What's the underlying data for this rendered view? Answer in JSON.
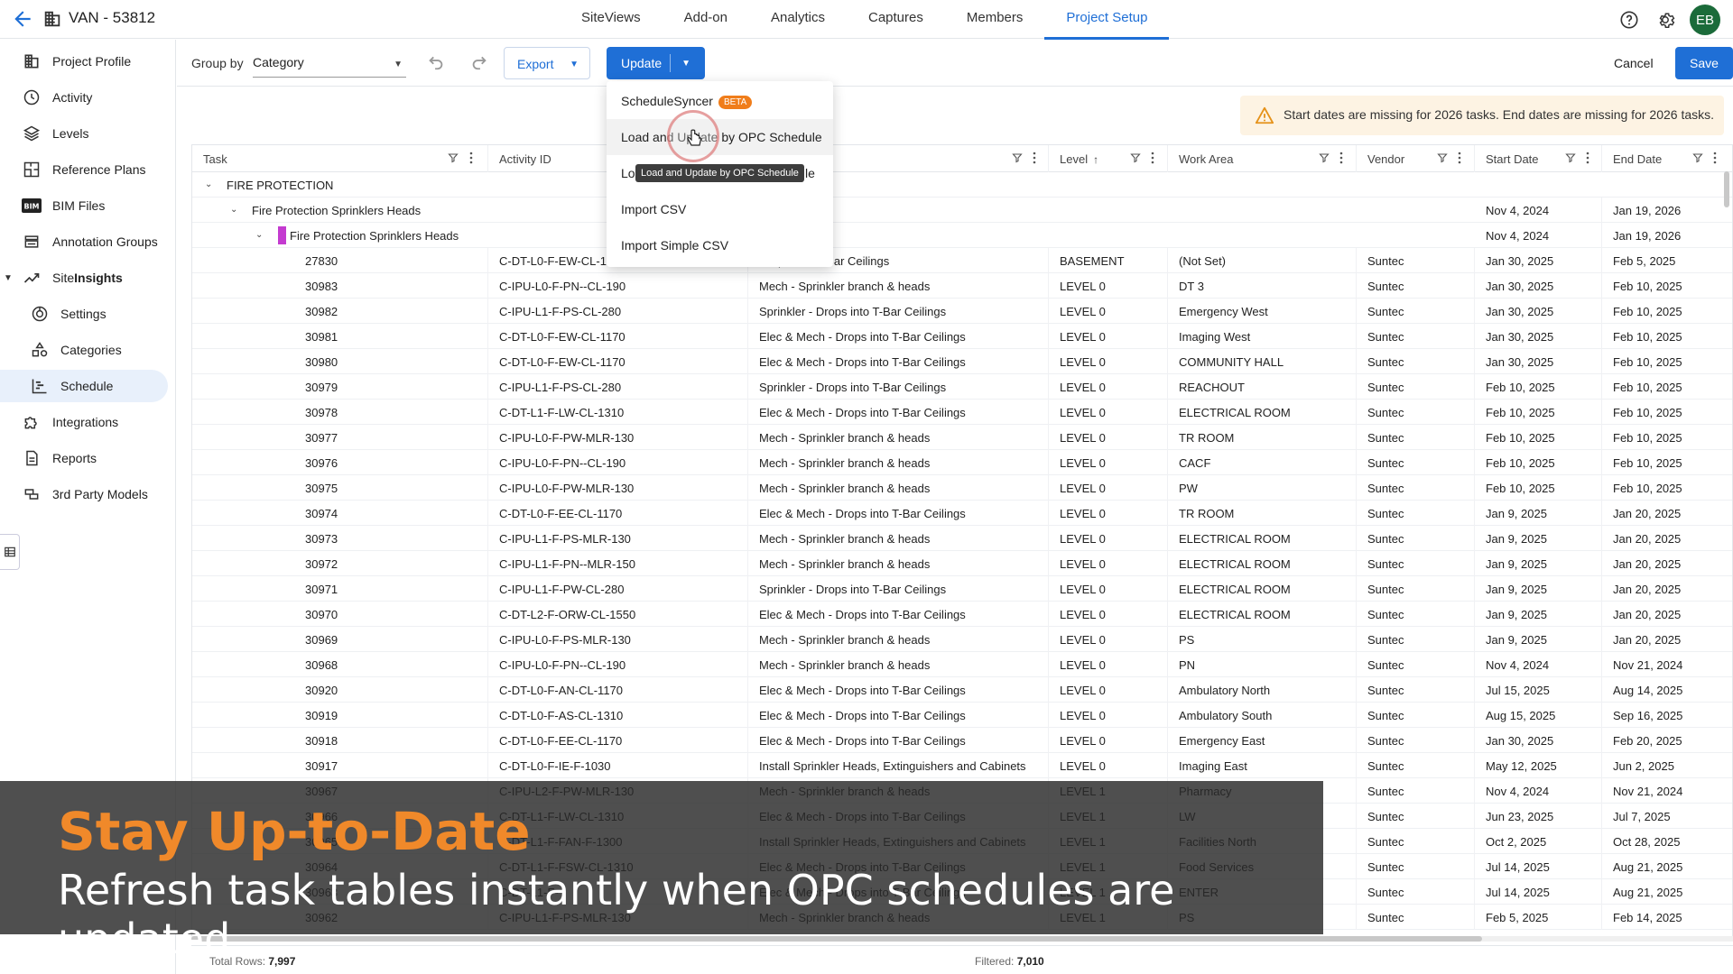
{
  "header": {
    "project_title": "VAN - 53812",
    "tabs": [
      "SiteViews",
      "Add-on",
      "Analytics",
      "Captures",
      "Members",
      "Project Setup"
    ],
    "active_tab": "Project Setup",
    "avatar_initials": "EB"
  },
  "sidebar": {
    "items": [
      {
        "label": "Project Profile",
        "icon": "building-icon"
      },
      {
        "label": "Activity",
        "icon": "clock-icon"
      },
      {
        "label": "Levels",
        "icon": "layers-icon"
      },
      {
        "label": "Reference Plans",
        "icon": "floorplan-icon"
      },
      {
        "label": "BIM Files",
        "icon": "bim-icon"
      },
      {
        "label": "Annotation Groups",
        "icon": "annotation-icon"
      },
      {
        "label": "SiteInsights",
        "icon": "trend-icon"
      },
      {
        "label": "Settings",
        "icon": "gauge-icon"
      },
      {
        "label": "Categories",
        "icon": "shapes-icon"
      },
      {
        "label": "Schedule",
        "icon": "gantt-icon"
      },
      {
        "label": "Integrations",
        "icon": "puzzle-icon"
      },
      {
        "label": "Reports",
        "icon": "report-icon"
      },
      {
        "label": "3rd Party Models",
        "icon": "models-icon"
      }
    ],
    "siteinsights_prefix": "Site",
    "siteinsights_suffix": "Insights",
    "active_item": "Schedule"
  },
  "toolbar": {
    "group_by_label": "Group by",
    "group_by_value": "Category",
    "export_label": "Export",
    "update_label": "Update",
    "cancel_label": "Cancel",
    "save_label": "Save"
  },
  "warning": {
    "text": "Start dates are missing for 2026 tasks. End dates are missing for 2026 tasks."
  },
  "update_menu": {
    "items": [
      {
        "label": "ScheduleSyncer",
        "badge": "BETA"
      },
      {
        "label": "Load and Update by OPC Schedule"
      },
      {
        "label": "Lo",
        "suffix": "le"
      },
      {
        "label": "Import CSV"
      },
      {
        "label": "Import Simple CSV"
      }
    ],
    "tooltip": "Load and Update by OPC Schedule"
  },
  "table": {
    "columns": [
      "Task",
      "Activity ID",
      "",
      "Level",
      "Work Area",
      "Vendor",
      "Start Date",
      "End Date"
    ],
    "group_rows": [
      {
        "label": "FIRE PROTECTION"
      },
      {
        "label": "Fire Protection Sprinklers Heads",
        "start": "Nov 4, 2024",
        "end": "Jan 19, 2026"
      },
      {
        "label": "Fire Protection Sprinklers Heads",
        "start": "Nov 4, 2024",
        "end": "Jan 19, 2026"
      }
    ],
    "rows": [
      [
        "27830",
        "C-DT-L0-F-EW-CL-1",
        "Drops into T-Bar Ceilings",
        "BASEMENT",
        "(Not Set)",
        "Suntec",
        "Jan 30, 2025",
        "Feb 5, 2025"
      ],
      [
        "30983",
        "C-IPU-L0-F-PN--CL-190",
        "Mech - Sprinkler branch & heads",
        "LEVEL 0",
        "DT 3",
        "Suntec",
        "Jan 30, 2025",
        "Feb 10, 2025"
      ],
      [
        "30982",
        "C-IPU-L1-F-PS-CL-280",
        "Sprinkler - Drops into T-Bar Ceilings",
        "LEVEL 0",
        "Emergency West",
        "Suntec",
        "Jan 30, 2025",
        "Feb 10, 2025"
      ],
      [
        "30981",
        "C-DT-L0-F-EW-CL-1170",
        "Elec & Mech - Drops into T-Bar Ceilings",
        "LEVEL 0",
        "Imaging West",
        "Suntec",
        "Jan 30, 2025",
        "Feb 10, 2025"
      ],
      [
        "30980",
        "C-DT-L0-F-EW-CL-1170",
        "Elec & Mech - Drops into T-Bar Ceilings",
        "LEVEL 0",
        "COMMUNITY HALL",
        "Suntec",
        "Jan 30, 2025",
        "Feb 10, 2025"
      ],
      [
        "30979",
        "C-IPU-L1-F-PS-CL-280",
        "Sprinkler - Drops into T-Bar Ceilings",
        "LEVEL 0",
        "REACHOUT",
        "Suntec",
        "Feb 10, 2025",
        "Feb 10, 2025"
      ],
      [
        "30978",
        "C-DT-L1-F-LW-CL-1310",
        "Elec & Mech - Drops into T-Bar Ceilings",
        "LEVEL 0",
        "ELECTRICAL ROOM",
        "Suntec",
        "Feb 10, 2025",
        "Feb 10, 2025"
      ],
      [
        "30977",
        "C-IPU-L0-F-PW-MLR-130",
        "Mech - Sprinkler branch & heads",
        "LEVEL 0",
        "TR ROOM",
        "Suntec",
        "Feb 10, 2025",
        "Feb 10, 2025"
      ],
      [
        "30976",
        "C-IPU-L0-F-PN--CL-190",
        "Mech - Sprinkler branch & heads",
        "LEVEL 0",
        "CACF",
        "Suntec",
        "Feb 10, 2025",
        "Feb 10, 2025"
      ],
      [
        "30975",
        "C-IPU-L0-F-PW-MLR-130",
        "Mech - Sprinkler branch & heads",
        "LEVEL 0",
        "PW",
        "Suntec",
        "Feb 10, 2025",
        "Feb 10, 2025"
      ],
      [
        "30974",
        "C-DT-L0-F-EE-CL-1170",
        "Elec & Mech - Drops into T-Bar Ceilings",
        "LEVEL 0",
        "TR ROOM",
        "Suntec",
        "Jan 9, 2025",
        "Jan 20, 2025"
      ],
      [
        "30973",
        "C-IPU-L1-F-PS-MLR-130",
        "Mech - Sprinkler branch & heads",
        "LEVEL 0",
        "ELECTRICAL ROOM",
        "Suntec",
        "Jan 9, 2025",
        "Jan 20, 2025"
      ],
      [
        "30972",
        "C-IPU-L1-F-PN--MLR-150",
        "Mech - Sprinkler branch & heads",
        "LEVEL 0",
        "ELECTRICAL ROOM",
        "Suntec",
        "Jan 9, 2025",
        "Jan 20, 2025"
      ],
      [
        "30971",
        "C-IPU-L1-F-PW-CL-280",
        "Sprinkler - Drops into T-Bar Ceilings",
        "LEVEL 0",
        "ELECTRICAL ROOM",
        "Suntec",
        "Jan 9, 2025",
        "Jan 20, 2025"
      ],
      [
        "30970",
        "C-DT-L2-F-ORW-CL-1550",
        "Elec & Mech - Drops into T-Bar Ceilings",
        "LEVEL 0",
        "ELECTRICAL ROOM",
        "Suntec",
        "Jan 9, 2025",
        "Jan 20, 2025"
      ],
      [
        "30969",
        "C-IPU-L0-F-PS-MLR-130",
        "Mech - Sprinkler branch & heads",
        "LEVEL 0",
        "PS",
        "Suntec",
        "Jan 9, 2025",
        "Jan 20, 2025"
      ],
      [
        "30968",
        "C-IPU-L0-F-PN--CL-190",
        "Mech - Sprinkler branch & heads",
        "LEVEL 0",
        "PN",
        "Suntec",
        "Nov 4, 2024",
        "Nov 21, 2024"
      ],
      [
        "30920",
        "C-DT-L0-F-AN-CL-1170",
        "Elec & Mech - Drops into T-Bar Ceilings",
        "LEVEL 0",
        "Ambulatory North",
        "Suntec",
        "Jul 15, 2025",
        "Aug 14, 2025"
      ],
      [
        "30919",
        "C-DT-L0-F-AS-CL-1310",
        "Elec & Mech - Drops into T-Bar Ceilings",
        "LEVEL 0",
        "Ambulatory South",
        "Suntec",
        "Aug 15, 2025",
        "Sep 16, 2025"
      ],
      [
        "30918",
        "C-DT-L0-F-EE-CL-1170",
        "Elec & Mech - Drops into T-Bar Ceilings",
        "LEVEL 0",
        "Emergency East",
        "Suntec",
        "Jan 30, 2025",
        "Feb 20, 2025"
      ],
      [
        "30917",
        "C-DT-L0-F-IE-F-1030",
        "Install Sprinkler Heads, Extinguishers and Cabinets",
        "LEVEL 0",
        "Imaging East",
        "Suntec",
        "May 12, 2025",
        "Jun 2, 2025"
      ],
      [
        "30967",
        "C-IPU-L2-F-PW-MLR-130",
        "Mech - Sprinkler branch & heads",
        "LEVEL 1",
        "Pharmacy",
        "Suntec",
        "Nov 4, 2024",
        "Nov 21, 2024"
      ],
      [
        "30966",
        "C-DT-L1-F-LW-CL-1310",
        "Elec & Mech - Drops into T-Bar Ceilings",
        "LEVEL 1",
        "LW",
        "Suntec",
        "Jun 23, 2025",
        "Jul 7, 2025"
      ],
      [
        "30965",
        "C-DT-L1-F-FAN-F-1300",
        "Install Sprinkler Heads, Extinguishers and Cabinets",
        "LEVEL 1",
        "Facilities North",
        "Suntec",
        "Oct 2, 2025",
        "Oct 28, 2025"
      ],
      [
        "30964",
        "C-DT-L1-F-FSW-CL-1310",
        "Elec & Mech - Drops into T-Bar Ceilings",
        "LEVEL 1",
        "Food Services",
        "Suntec",
        "Jul 14, 2025",
        "Aug 21, 2025"
      ],
      [
        "30963",
        "C-DT-L1-F-",
        "Elec & Mech - Drops into T-Bar Ceilings",
        "LEVEL 1",
        "ENTER",
        "Suntec",
        "Jul 14, 2025",
        "Aug 21, 2025"
      ],
      [
        "30962",
        "C-IPU-L1-F-PS-MLR-130",
        "Mech - Sprinkler branch & heads",
        "LEVEL 1",
        "PS",
        "Suntec",
        "Feb 5, 2025",
        "Feb 14, 2025"
      ]
    ]
  },
  "footer": {
    "total_label": "Total Rows:",
    "total_value": "7,997",
    "filtered_label": "Filtered:",
    "filtered_value": "7,010"
  },
  "overlay": {
    "title": "Stay Up-to-Date",
    "subtitle": "Refresh task tables instantly when OPC schedules are updated."
  },
  "colors": {
    "accent": "#1f6fd6",
    "warning": "#e5921a",
    "beta": "#f07d1a",
    "overlay_title": "#f0892a",
    "group_color": "#c43bd0"
  }
}
